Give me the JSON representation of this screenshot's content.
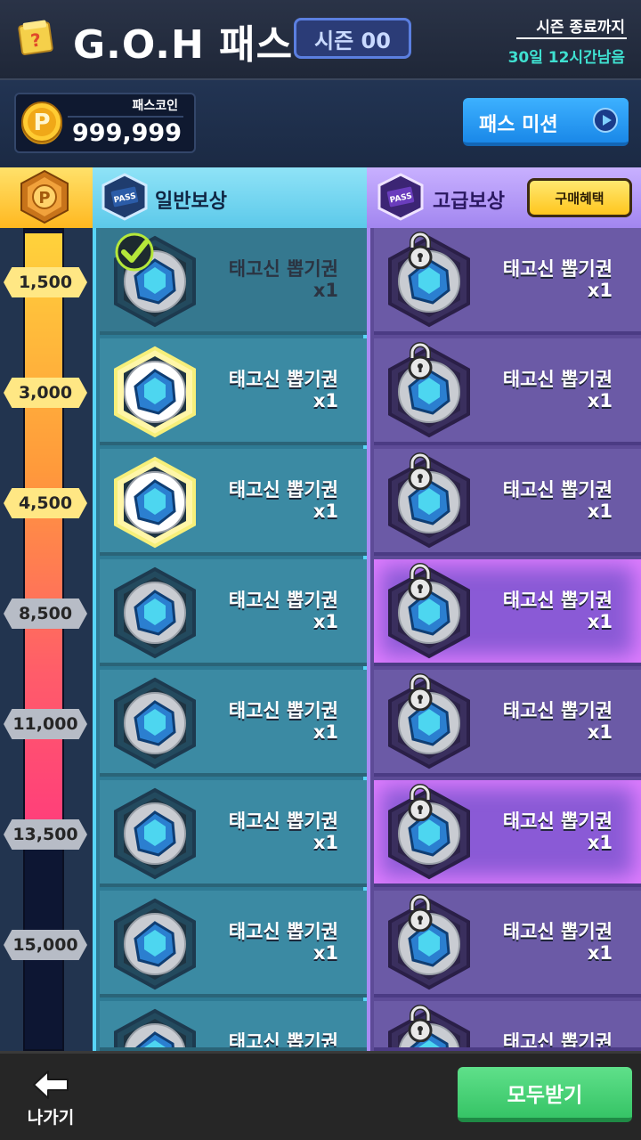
{
  "header": {
    "title": "G.O.H 패스",
    "season": "시즌 00",
    "season_end_label": "시즌 종료까지",
    "season_remaining": "30일 12시간남음"
  },
  "coin": {
    "label": "패스코인",
    "value": "999,999"
  },
  "mission_button": {
    "label": "패스 미션"
  },
  "columns": {
    "normal_label": "일반보상",
    "premium_label": "고급보상",
    "buy_button": "구매혜택",
    "pass_badge": "PASS"
  },
  "progress": {
    "fraction": 0.72
  },
  "milestones": [
    {
      "value": "1,500",
      "state": "active"
    },
    {
      "value": "3,000",
      "state": "active"
    },
    {
      "value": "4,500",
      "state": "active"
    },
    {
      "value": "8,500",
      "state": "locked"
    },
    {
      "value": "11,000",
      "state": "locked"
    },
    {
      "value": "13,500",
      "state": "locked"
    },
    {
      "value": "15,000",
      "state": "locked"
    }
  ],
  "normal_rewards": [
    {
      "name": "태고신 뽑기권",
      "qty": "x1",
      "state": "claimed"
    },
    {
      "name": "태고신 뽑기권",
      "qty": "x1",
      "state": "claimable"
    },
    {
      "name": "태고신 뽑기권",
      "qty": "x1",
      "state": "claimable"
    },
    {
      "name": "태고신 뽑기권",
      "qty": "x1",
      "state": "locked"
    },
    {
      "name": "태고신 뽑기권",
      "qty": "x1",
      "state": "locked"
    },
    {
      "name": "태고신 뽑기권",
      "qty": "x1",
      "state": "locked"
    },
    {
      "name": "태고신 뽑기권",
      "qty": "x1",
      "state": "locked"
    },
    {
      "name": "태고신 뽑기권",
      "qty": "",
      "state": "locked"
    }
  ],
  "premium_rewards": [
    {
      "name": "태고신 뽑기권",
      "qty": "x1",
      "state": "locked"
    },
    {
      "name": "태고신 뽑기권",
      "qty": "x1",
      "state": "locked"
    },
    {
      "name": "태고신 뽑기권",
      "qty": "x1",
      "state": "locked"
    },
    {
      "name": "태고신 뽑기권",
      "qty": "x1",
      "state": "highlighted"
    },
    {
      "name": "태고신 뽑기권",
      "qty": "x1",
      "state": "locked"
    },
    {
      "name": "태고신 뽑기권",
      "qty": "x1",
      "state": "highlighted"
    },
    {
      "name": "태고신 뽑기권",
      "qty": "x1",
      "state": "locked"
    },
    {
      "name": "태고신 뽑기권",
      "qty": "",
      "state": "locked"
    }
  ],
  "footer": {
    "back_label": "나가기",
    "claim_all_label": "모두받기"
  },
  "colors": {
    "normal_accent": "#58d5f7",
    "premium_accent": "#a98bf2",
    "claim_green": "#36c466",
    "coin_gold": "#ffc61e"
  }
}
